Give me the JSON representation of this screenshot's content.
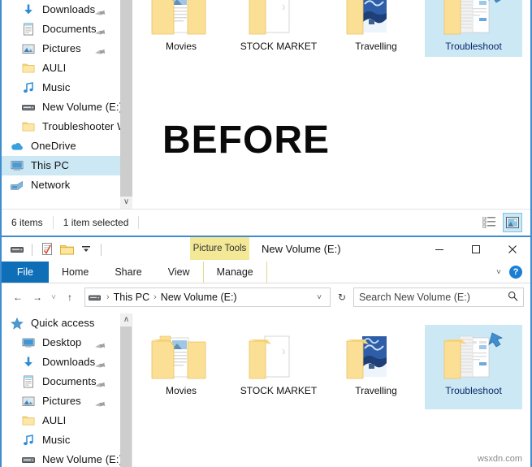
{
  "annotation": {
    "before_label": "BEFORE",
    "watermark": "wsxdn.com"
  },
  "top_window": {
    "nav_items": [
      {
        "label": "Downloads",
        "icon": "downloads-icon",
        "pinned": true,
        "indent": true,
        "selected": false
      },
      {
        "label": "Documents",
        "icon": "documents-icon",
        "pinned": true,
        "indent": true,
        "selected": false
      },
      {
        "label": "Pictures",
        "icon": "pictures-icon",
        "pinned": true,
        "indent": true,
        "selected": false
      },
      {
        "label": "AULI",
        "icon": "folder-icon",
        "pinned": false,
        "indent": true,
        "selected": false
      },
      {
        "label": "Music",
        "icon": "music-icon",
        "pinned": false,
        "indent": true,
        "selected": false
      },
      {
        "label": "New Volume (E:)",
        "icon": "drive-icon",
        "pinned": false,
        "indent": true,
        "selected": false
      },
      {
        "label": "Troubleshooter W",
        "icon": "folder-icon",
        "pinned": false,
        "indent": true,
        "selected": false
      },
      {
        "label": "OneDrive",
        "icon": "onedrive-icon",
        "pinned": false,
        "indent": false,
        "selected": false
      },
      {
        "label": "This PC",
        "icon": "thispc-icon",
        "pinned": false,
        "indent": false,
        "selected": true
      },
      {
        "label": "Network",
        "icon": "network-icon",
        "pinned": false,
        "indent": false,
        "selected": false
      }
    ],
    "folders": [
      {
        "label": "Movies",
        "icon": "folder-movies-icon",
        "selected": false
      },
      {
        "label": "STOCK MARKET",
        "icon": "folder-stock-icon",
        "selected": false
      },
      {
        "label": "Travelling",
        "icon": "folder-travel-icon",
        "selected": false
      },
      {
        "label": "Troubleshoot",
        "icon": "folder-trouble-icon",
        "selected": true
      }
    ],
    "status": {
      "items_count": "6 items",
      "selection": "1 item selected"
    },
    "view_buttons": [
      {
        "name": "details-view-button",
        "active": false
      },
      {
        "name": "large-icons-view-button",
        "active": true
      }
    ]
  },
  "bottom_window": {
    "title": "New Volume (E:)",
    "contextual_tab": "Picture Tools",
    "quick_access_toolbar": [
      {
        "name": "drive-icon"
      },
      {
        "name": "properties-icon"
      },
      {
        "name": "new-folder-icon"
      },
      {
        "name": "customize-dropdown-icon"
      }
    ],
    "window_controls": [
      {
        "name": "minimize-button",
        "glyph": "–"
      },
      {
        "name": "maximize-button",
        "glyph": "□"
      },
      {
        "name": "close-button",
        "glyph": "✕"
      }
    ],
    "ribbon_tabs": [
      {
        "label": "File",
        "kind": "file"
      },
      {
        "label": "Home",
        "kind": "tab"
      },
      {
        "label": "Share",
        "kind": "tab"
      },
      {
        "label": "View",
        "kind": "tab"
      },
      {
        "label": "Manage",
        "kind": "contextual"
      }
    ],
    "ribbon_right": {
      "expand_label": "˅",
      "help_label": "?"
    },
    "address": {
      "back_glyph": "←",
      "forward_glyph": "→",
      "recent_glyph": "˅",
      "up_glyph": "↑",
      "crumbs": [
        "This PC",
        "New Volume (E:)"
      ],
      "dropdown_glyph": "˅",
      "refresh_glyph": "↻"
    },
    "search": {
      "placeholder": "Search New Volume (E:)",
      "icon": "search-icon"
    },
    "nav_items": [
      {
        "label": "Quick access",
        "icon": "quickaccess-icon",
        "pinned": false,
        "indent": false,
        "selected": false
      },
      {
        "label": "Desktop",
        "icon": "desktop-icon",
        "pinned": true,
        "indent": true,
        "selected": false
      },
      {
        "label": "Downloads",
        "icon": "downloads-icon",
        "pinned": true,
        "indent": true,
        "selected": false
      },
      {
        "label": "Documents",
        "icon": "documents-icon",
        "pinned": true,
        "indent": true,
        "selected": false
      },
      {
        "label": "Pictures",
        "icon": "pictures-icon",
        "pinned": true,
        "indent": true,
        "selected": false
      },
      {
        "label": "AULI",
        "icon": "folder-icon",
        "pinned": false,
        "indent": true,
        "selected": false
      },
      {
        "label": "Music",
        "icon": "music-icon",
        "pinned": false,
        "indent": true,
        "selected": false
      },
      {
        "label": "New Volume (E:)",
        "icon": "drive-icon",
        "pinned": false,
        "indent": true,
        "selected": false
      }
    ],
    "folders": [
      {
        "label": "Movies",
        "icon": "folder-movies-icon",
        "selected": false
      },
      {
        "label": "STOCK MARKET",
        "icon": "folder-stock-icon",
        "selected": false
      },
      {
        "label": "Travelling",
        "icon": "folder-travel-icon",
        "selected": false
      },
      {
        "label": "Troubleshoot",
        "icon": "folder-trouble-icon",
        "selected": true
      }
    ]
  },
  "colors": {
    "window_border": "#3f8cd0",
    "selection": "#cce8f4",
    "file_tab": "#0e6eb8",
    "contextual_tab": "#f2e896",
    "folder_yellow": "#fbe08a"
  }
}
